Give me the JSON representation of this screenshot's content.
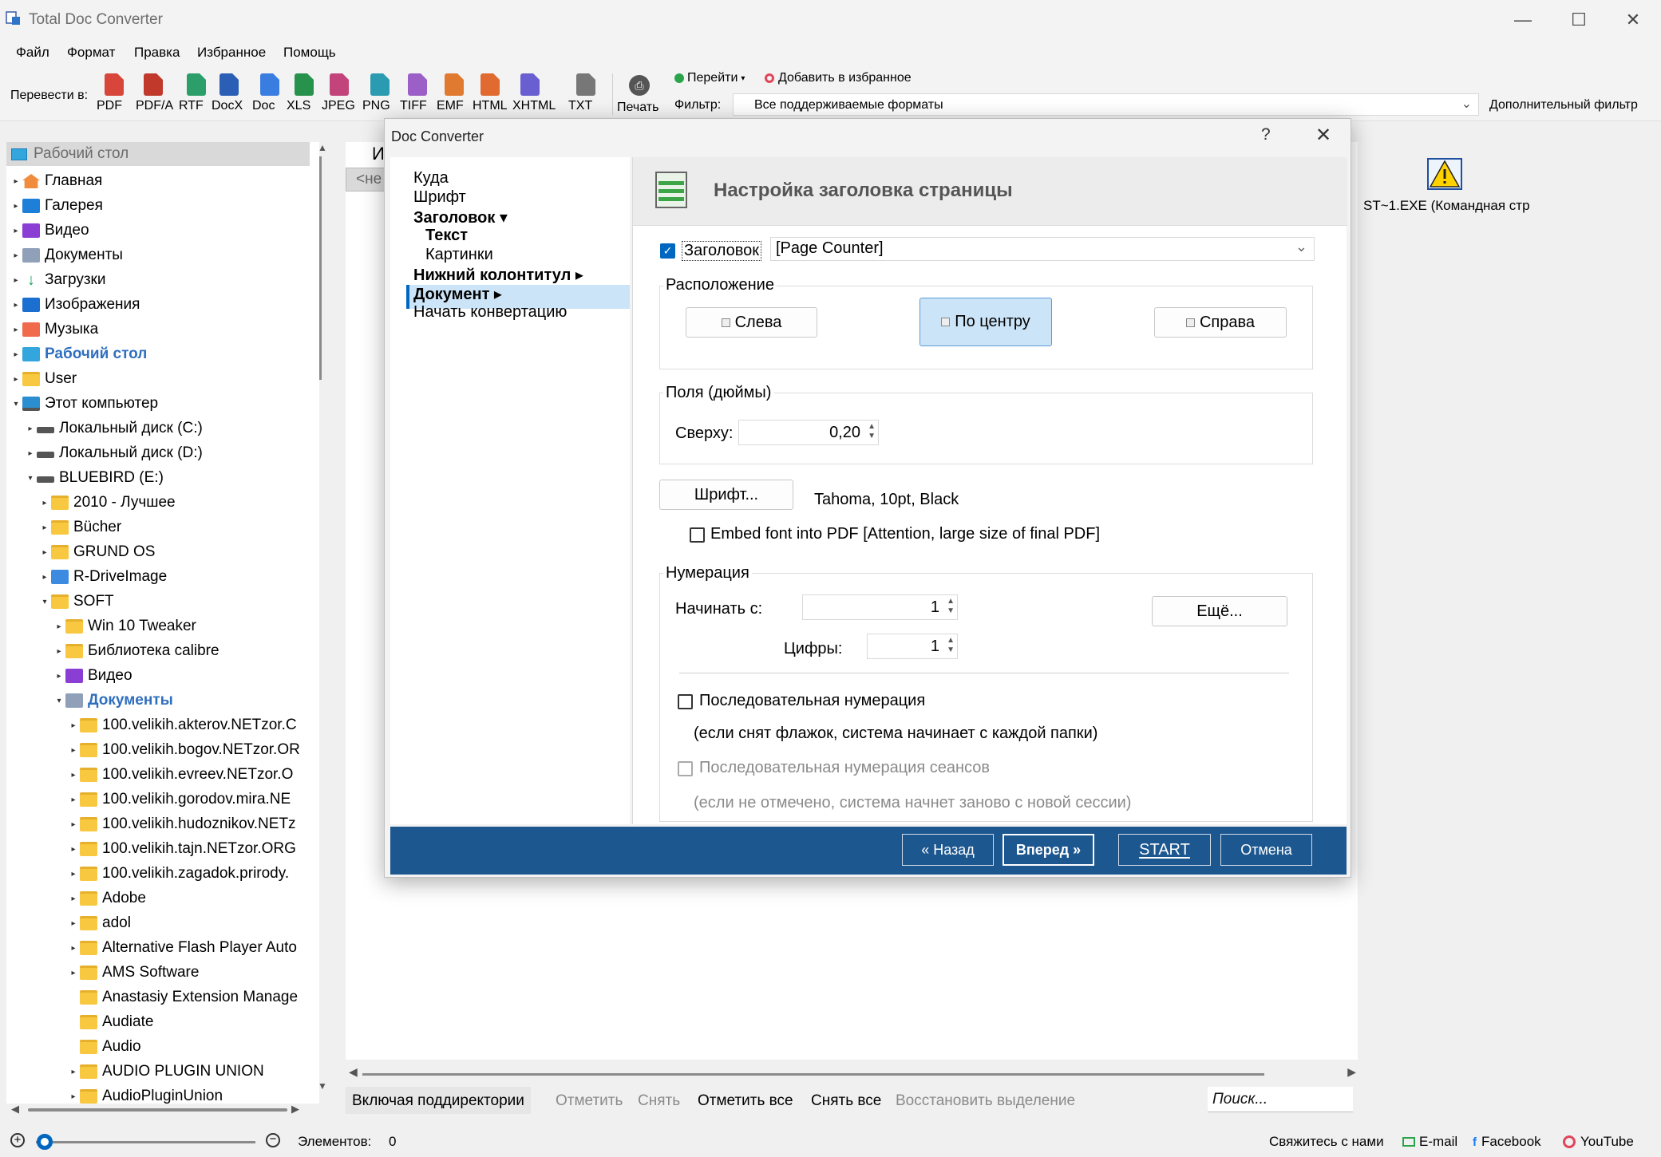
{
  "window": {
    "title": "Total Doc Converter",
    "controls": {
      "minimize": "—",
      "maximize": "☐",
      "close": "✕"
    }
  },
  "menu": [
    "Файл",
    "Формат",
    "Правка",
    "Избранное",
    "Помощь"
  ],
  "toolbar": {
    "convert_label": "Перевести в:",
    "formats": [
      {
        "label": "PDF",
        "color": "#d8453a"
      },
      {
        "label": "PDF/A",
        "color": "#c0392b"
      },
      {
        "label": "RTF",
        "color": "#2b9e6a"
      },
      {
        "label": "DocX",
        "color": "#2b5fb5"
      },
      {
        "label": "Doc",
        "color": "#3a7de0"
      },
      {
        "label": "XLS",
        "color": "#27924c"
      },
      {
        "label": "JPEG",
        "color": "#c2447a"
      },
      {
        "label": "PNG",
        "color": "#2a9bb0"
      },
      {
        "label": "TIFF",
        "color": "#9b5fc7"
      },
      {
        "label": "EMF",
        "color": "#e07a30"
      },
      {
        "label": "HTML",
        "color": "#e06a30"
      },
      {
        "label": "XHTML",
        "color": "#6a5fd0"
      },
      {
        "label": "TXT",
        "color": "#777777"
      }
    ],
    "print_label": "Печать",
    "goto_label": "Перейти",
    "favorites_label": "Добавить в избранное",
    "filter_label": "Фильтр:",
    "filter_value": "Все поддерживаемые форматы",
    "extra_filter_label": "Дополнительный фильтр"
  },
  "tree": {
    "header": "Рабочий стол",
    "items": [
      {
        "label": "Главная",
        "icon": "home-icon",
        "arrow": "▸"
      },
      {
        "label": "Галерея",
        "icon": "gallery-icon",
        "arrow": "▸"
      },
      {
        "label": "Видео",
        "icon": "video-icon",
        "arrow": "▸"
      },
      {
        "label": "Документы",
        "icon": "documents-icon",
        "arrow": "▸"
      },
      {
        "label": "Загрузки",
        "icon": "download-icon",
        "arrow": "▸"
      },
      {
        "label": "Изображения",
        "icon": "images-icon",
        "arrow": "▸"
      },
      {
        "label": "Музыка",
        "icon": "music-icon",
        "arrow": "▸"
      },
      {
        "label": "Рабочий стол",
        "icon": "desktop-icon",
        "arrow": "▸"
      },
      {
        "label": "User",
        "icon": "folder-icon",
        "arrow": "▸"
      },
      {
        "label": "Этот компьютер",
        "icon": "computer-icon",
        "arrow": "▾"
      },
      {
        "label": "Локальный диск (C:)",
        "icon": "disk-icon",
        "arrow": "▸"
      },
      {
        "label": "Локальный диск (D:)",
        "icon": "disk-icon",
        "arrow": "▸"
      },
      {
        "label": "BLUEBIRD (E:)",
        "icon": "disk-icon",
        "arrow": "▾"
      },
      {
        "label": "2010 - Лучшее",
        "icon": "folder-icon",
        "arrow": "▸"
      },
      {
        "label": "Bücher",
        "icon": "folder-icon",
        "arrow": "▸"
      },
      {
        "label": "GRUND OS",
        "icon": "folder-icon",
        "arrow": "▸"
      },
      {
        "label": "R-DriveImage",
        "icon": "r-drive-icon",
        "arrow": "▸"
      },
      {
        "label": "SOFT",
        "icon": "folder-icon",
        "arrow": "▾"
      },
      {
        "label": "Win 10 Tweaker",
        "icon": "folder-icon",
        "arrow": "▸"
      },
      {
        "label": "Библиотека calibre",
        "icon": "folder-icon",
        "arrow": "▸"
      },
      {
        "label": "Видео",
        "icon": "video-icon",
        "arrow": "▸"
      },
      {
        "label": "Документы",
        "icon": "documents-icon",
        "arrow": "▾"
      },
      {
        "label": "100.velikih.akterov.NETzor.C",
        "icon": "folder-icon",
        "arrow": "▸"
      },
      {
        "label": "100.velikih.bogov.NETzor.OR",
        "icon": "folder-icon",
        "arrow": "▸"
      },
      {
        "label": "100.velikih.evreev.NETzor.O",
        "icon": "folder-icon",
        "arrow": "▸"
      },
      {
        "label": "100.velikih.gorodov.mira.NE",
        "icon": "folder-icon",
        "arrow": "▸"
      },
      {
        "label": "100.velikih.hudoznikov.NETz",
        "icon": "folder-icon",
        "arrow": "▸"
      },
      {
        "label": "100.velikih.tajn.NETzor.ORG",
        "icon": "folder-icon",
        "arrow": "▸"
      },
      {
        "label": "100.velikih.zagadok.prirody.",
        "icon": "folder-icon",
        "arrow": "▸"
      },
      {
        "label": "Adobe",
        "icon": "folder-icon",
        "arrow": "▸"
      },
      {
        "label": "adol",
        "icon": "folder-icon",
        "arrow": "▸"
      },
      {
        "label": "Alternative Flash Player Auto",
        "icon": "folder-icon",
        "arrow": "▸"
      },
      {
        "label": "AMS Software",
        "icon": "folder-icon",
        "arrow": "▸"
      },
      {
        "label": "Anastasiy Extension Manage",
        "icon": "folder-icon",
        "arrow": ""
      },
      {
        "label": "Audiate",
        "icon": "folder-icon",
        "arrow": ""
      },
      {
        "label": "Audio",
        "icon": "folder-icon",
        "arrow": ""
      },
      {
        "label": "AUDIO PLUGIN UNION",
        "icon": "folder-icon",
        "arrow": "▸"
      },
      {
        "label": "AudioPluginUnion",
        "icon": "folder-icon",
        "arrow": "▸"
      }
    ]
  },
  "middle": {
    "column_header": "И",
    "back_button": "<не"
  },
  "right_panel": {
    "file_label": "ST~1.EXE (Командная стр"
  },
  "bottom_bar": {
    "include_subdirs": "Включая поддиректории",
    "mark": "Отметить",
    "unmark": "Снять",
    "mark_all": "Отметить все",
    "unmark_all": "Снять все",
    "restore_selection": "Восстановить выделение",
    "search_placeholder": "Поиск..."
  },
  "statusbar": {
    "items_label": "Элементов:",
    "items_count": "0",
    "contact": "Свяжитесь с нами",
    "email": "E-mail",
    "facebook": "Facebook",
    "youtube": "YouTube"
  },
  "dialog": {
    "title": "Doc Converter",
    "help": "?",
    "close": "✕",
    "nav": [
      {
        "label": "Куда"
      },
      {
        "label": "Шрифт"
      },
      {
        "label": "Заголовок ▾"
      },
      {
        "label": "Текст"
      },
      {
        "label": "Картинки"
      },
      {
        "label": "Нижний колонтитул ▸"
      },
      {
        "label": "Документ ▸"
      },
      {
        "label": "Начать конвертацию"
      }
    ],
    "heading": "Настройка заголовка страницы",
    "header_checkbox_label": "Заголовок",
    "header_checked": true,
    "header_value": "[Page Counter]",
    "position": {
      "title": "Расположение",
      "left": "Слева",
      "center": "По центру",
      "right": "Справа",
      "selected": "center"
    },
    "margins": {
      "title": "Поля (дюймы)",
      "top_label": "Сверху:",
      "top_value": "0,20"
    },
    "font_button": "Шрифт...",
    "font_value": "Tahoma, 10pt, Black",
    "embed_label": "Embed font into PDF  [Attention, large size of final PDF]",
    "numbering": {
      "title": "Нумерация",
      "start_label": "Начинать с:",
      "start_value": "1",
      "digits_label": "Цифры:",
      "digits_value": "1",
      "more_button": "Ещё...",
      "sequential_label": "Последовательная нумерация",
      "sequential_note": "(если снят флажок, система начинает с каждой папки)",
      "session_label": "Последовательная нумерация сеансов",
      "session_note": "(если не отмечено, система начнет заново с новой сессии)"
    },
    "footer": {
      "back": "« Назад",
      "next": "Вперед »",
      "start": "START",
      "cancel": "Отмена"
    }
  }
}
